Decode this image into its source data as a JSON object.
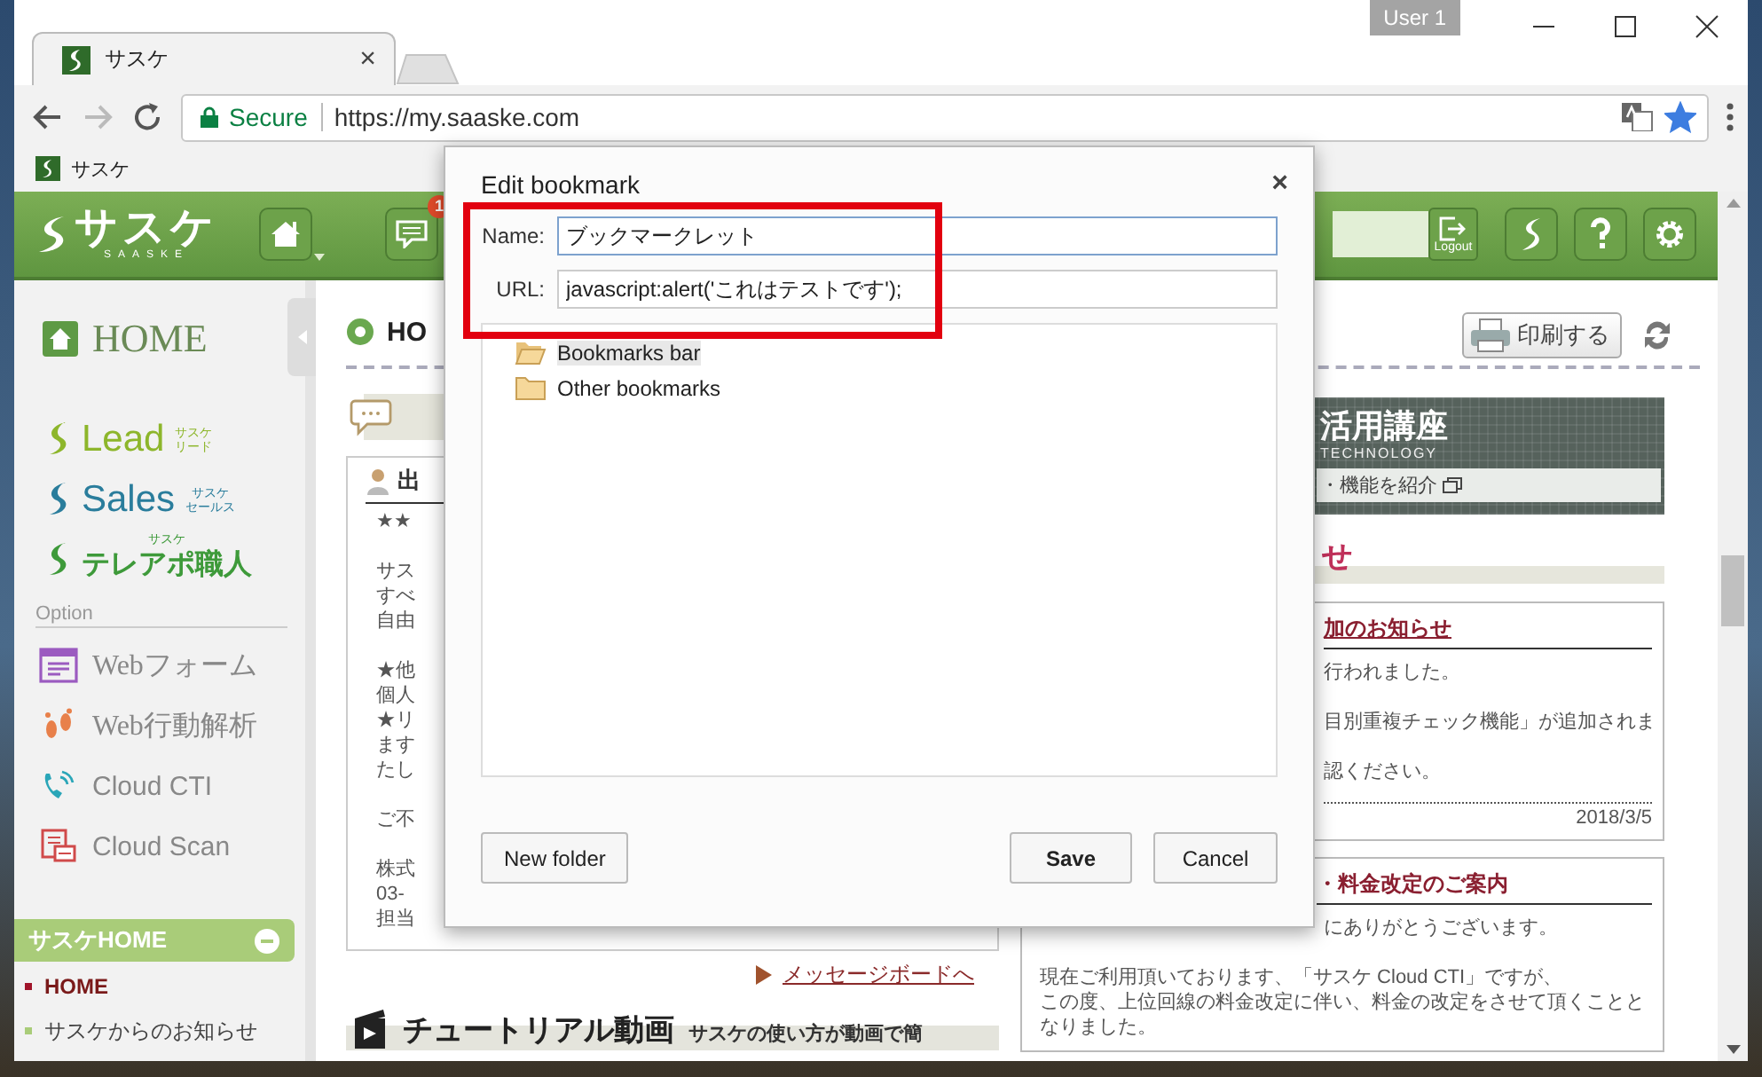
{
  "browser": {
    "tab": {
      "title": "サスケ",
      "close": "×"
    },
    "profile": "User 1",
    "address": {
      "security": "Secure",
      "url": "https://my.saaske.com",
      "bookmarked": true
    },
    "bookmarks_bar": [
      {
        "label": "サスケ"
      }
    ]
  },
  "header": {
    "logo": "サスケ",
    "logo_sub": "SAASKE",
    "message_count": "1",
    "logout": "Logout"
  },
  "sidebar": {
    "home": "HOME",
    "products": [
      {
        "kind": "side",
        "name": "Lead",
        "sub": [
          "サスケ",
          "リード"
        ],
        "color": "#8db62b"
      },
      {
        "kind": "side",
        "name": "Sales",
        "sub": [
          "サスケ",
          "セールス"
        ],
        "color": "#2a7d9c"
      },
      {
        "kind": "top",
        "name": "テレアポ職人",
        "sub": [
          "サスケ"
        ],
        "color": "#3e9a3a"
      }
    ],
    "option_label": "Option",
    "options": [
      {
        "kind": "form",
        "label": "Webフォーム"
      },
      {
        "kind": "footprints",
        "label": "Web行動解析"
      },
      {
        "kind": "phone",
        "label": "Cloud CTI"
      },
      {
        "kind": "scan",
        "label": "Cloud Scan"
      }
    ],
    "section": {
      "title": "サスケHOME",
      "expanded": true,
      "items": [
        {
          "label": "HOME",
          "selected": true
        },
        {
          "label": "サスケからのお知らせ",
          "selected": false
        }
      ]
    }
  },
  "main": {
    "heading": "HO",
    "print": "印刷する",
    "message_panel": {
      "title": "出",
      "paragraphs": [
        [
          "★★"
        ],
        [
          "サス",
          "すべ",
          "自由"
        ],
        [
          "★他",
          "個人",
          "★リ",
          "ます",
          "たし"
        ],
        [
          "ご不"
        ],
        [
          "株式",
          "03-",
          "担当"
        ]
      ]
    },
    "board_link": "メッセージボードへ",
    "tutorial": {
      "title": "チュートリアル動画",
      "subtitle": "サスケの使い方が動画で簡"
    },
    "banner": {
      "title": "活用講座",
      "subtitle": "TECHNOLOGY",
      "link": "・機能を紹介"
    },
    "notices_heading": "せ",
    "notices": [
      {
        "title": "加のお知らせ",
        "paragraphs": [
          [
            "行われました。"
          ],
          [
            "目別重複チェック機能」が追加されま"
          ],
          [
            "認ください。"
          ]
        ],
        "date": "2018/3/5"
      },
      {
        "title": "・料金改定のご案内",
        "paragraphs": [
          [
            "にありがとうございます。"
          ],
          [
            "現在ご利用頂いております、「サスケ Cloud CTI」ですが、",
            "この度、上位回線の料金改定に伴い、料金の改定をさせて頂くことと",
            "なりました。"
          ]
        ]
      }
    ]
  },
  "dialog": {
    "title": "Edit bookmark",
    "close": "×",
    "fields": [
      {
        "label": "Name:",
        "value": "ブックマークレット",
        "focused": true
      },
      {
        "label": "URL:",
        "value": "javascript:alert('これはテストです');",
        "focused": false
      }
    ],
    "folders": [
      {
        "label": "Bookmarks bar",
        "selected": true
      },
      {
        "label": "Other bookmarks",
        "selected": false
      }
    ],
    "buttons": [
      {
        "label": "New folder",
        "kind": "secondary"
      },
      {
        "label": "Save",
        "kind": "default"
      },
      {
        "label": "Cancel",
        "kind": "secondary"
      }
    ]
  }
}
